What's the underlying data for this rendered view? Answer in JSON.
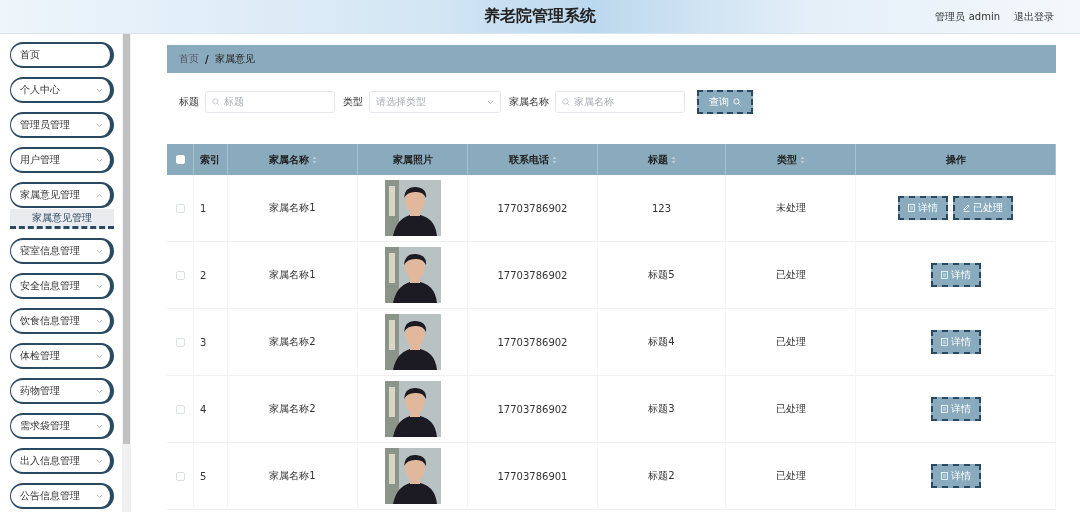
{
  "header": {
    "title": "养老院管理系统",
    "user": "管理员 admin",
    "logout": "退出登录"
  },
  "sidebar": {
    "items": [
      {
        "label": "首页"
      },
      {
        "label": "个人中心"
      },
      {
        "label": "管理员管理"
      },
      {
        "label": "用户管理"
      },
      {
        "label": "家属意见管理",
        "expanded": true,
        "children": [
          {
            "label": "家属意见管理",
            "selected": true
          }
        ]
      },
      {
        "label": "寝室信息管理"
      },
      {
        "label": "安全信息管理"
      },
      {
        "label": "饮食信息管理"
      },
      {
        "label": "体检管理"
      },
      {
        "label": "药物管理"
      },
      {
        "label": "需求袋管理"
      },
      {
        "label": "出入信息管理"
      },
      {
        "label": "公告信息管理"
      }
    ]
  },
  "breadcrumb": {
    "items": [
      "首页",
      "家属意见"
    ],
    "separator": "/"
  },
  "search": {
    "fields": [
      {
        "kind": "input",
        "label": "标题",
        "placeholder": "标题"
      },
      {
        "kind": "select",
        "label": "类型",
        "placeholder": "请选择类型"
      },
      {
        "kind": "input",
        "label": "家属名称",
        "placeholder": "家属名称"
      }
    ],
    "button": "查询"
  },
  "table": {
    "select_all": {
      "checked": false
    },
    "columns": [
      {
        "label": "索引",
        "sortable": false
      },
      {
        "label": "家属名称",
        "sortable": true
      },
      {
        "label": "家属照片",
        "sortable": false
      },
      {
        "label": "联系电话",
        "sortable": true
      },
      {
        "label": "标题",
        "sortable": true
      },
      {
        "label": "类型",
        "sortable": true
      },
      {
        "label": "操作",
        "sortable": false
      }
    ],
    "rows": [
      {
        "checked": false,
        "index": "1",
        "name": "家属名称1",
        "photo": {
          "kind": "picture"
        },
        "phone": "17703786902",
        "title": "123",
        "type": "未处理",
        "actions": [
          {
            "kind": "detail",
            "label": "详情"
          },
          {
            "kind": "process",
            "label": "已处理"
          }
        ]
      },
      {
        "checked": false,
        "index": "2",
        "name": "家属名称1",
        "photo": {
          "kind": "picture"
        },
        "phone": "17703786902",
        "title": "标题5",
        "type": "已处理",
        "actions": [
          {
            "kind": "detail",
            "label": "详情"
          }
        ]
      },
      {
        "checked": false,
        "index": "3",
        "name": "家属名称2",
        "photo": {
          "kind": "picture"
        },
        "phone": "17703786902",
        "title": "标题4",
        "type": "已处理",
        "actions": [
          {
            "kind": "detail",
            "label": "详情"
          }
        ]
      },
      {
        "checked": false,
        "index": "4",
        "name": "家属名称2",
        "photo": {
          "kind": "picture"
        },
        "phone": "17703786902",
        "title": "标题3",
        "type": "已处理",
        "actions": [
          {
            "kind": "detail",
            "label": "详情"
          }
        ]
      },
      {
        "checked": false,
        "index": "5",
        "name": "家属名称1",
        "photo": {
          "kind": "picture"
        },
        "phone": "17703786901",
        "title": "标题2",
        "type": "已处理",
        "actions": [
          {
            "kind": "detail",
            "label": "详情"
          }
        ]
      }
    ]
  }
}
